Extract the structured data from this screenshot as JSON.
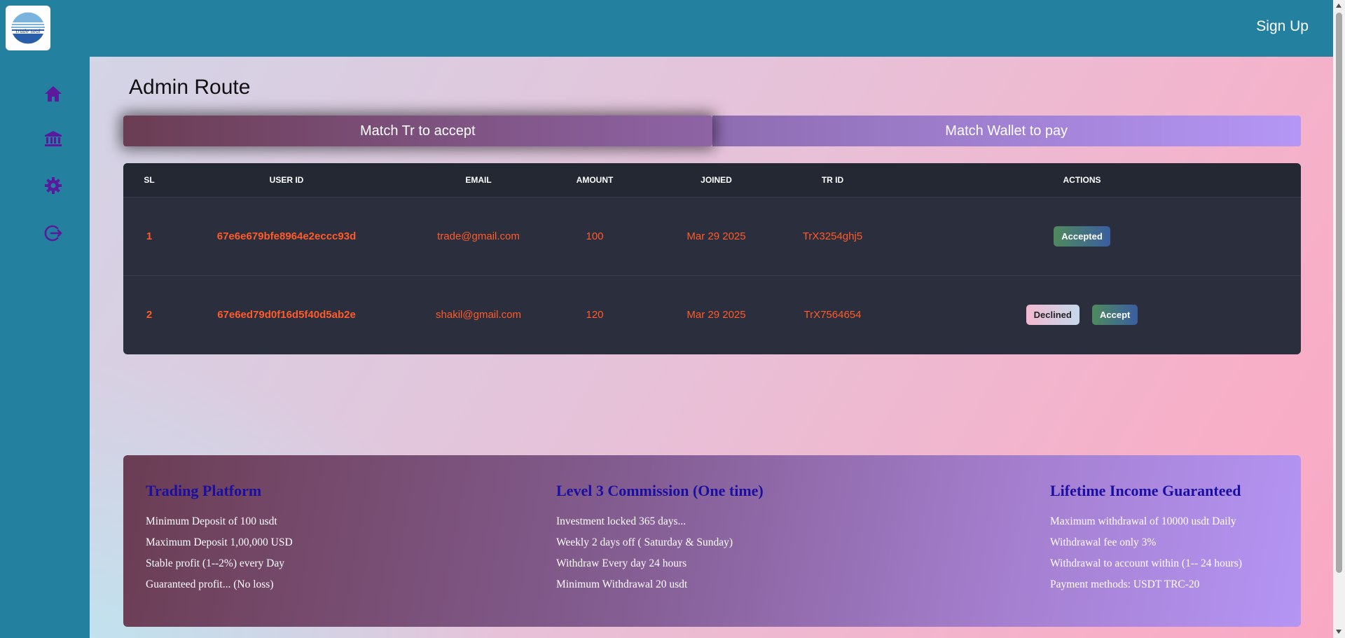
{
  "header": {
    "logo_text": "trade seal",
    "signup_label": "Sign Up"
  },
  "sidebar": {
    "items": [
      {
        "icon": "home-icon"
      },
      {
        "icon": "bank-icon"
      },
      {
        "icon": "gear-icon"
      },
      {
        "icon": "logout-icon"
      }
    ],
    "icon_color": "#5b1a9e"
  },
  "main": {
    "page_title": "Admin Route",
    "tabs": [
      {
        "label": "Match Tr to accept",
        "active": true
      },
      {
        "label": "Match Wallet to pay",
        "active": false
      }
    ]
  },
  "table": {
    "headers": [
      "SL",
      "USER ID",
      "EMAIL",
      "AMOUNT",
      "JOINED",
      "TR ID",
      "ACTIONS"
    ],
    "rows": [
      {
        "sl": "1",
        "user_id": "67e6e679bfe8964e2eccc93d",
        "email": "trade@gmail.com",
        "amount": "100",
        "joined": "Mar 29 2025",
        "tr_id": "TrX3254ghj5",
        "actions": [
          "Accepted"
        ]
      },
      {
        "sl": "2",
        "user_id": "67e6ed79d0f16d5f40d5ab2e",
        "email": "shakil@gmail.com",
        "amount": "120",
        "joined": "Mar 29 2025",
        "tr_id": "TrX7564654",
        "actions": [
          "Declined",
          "Accept"
        ]
      }
    ]
  },
  "footer": {
    "columns": [
      {
        "title": "Trading Platform",
        "lines": [
          "Minimum Deposit of 100 usdt",
          "Maximum Deposit 1,00,000 USD",
          "Stable profit (1--2%) every Day",
          "Guaranteed profit... (No loss)"
        ]
      },
      {
        "title": "Level 3 Commission (One time)",
        "lines": [
          "Investment locked 365 days...",
          "Weekly 2 days off ( Saturday & Sunday)",
          "Withdraw Every day 24 hours",
          "Minimum Withdrawal 20 usdt"
        ]
      },
      {
        "title": "Lifetime Income Guaranteed",
        "lines": [
          "Maximum withdrawal of 10000 usdt Daily",
          "Withdrawal fee only 3%",
          "Withdrawal to account within (1-- 24 hours)",
          "Payment methods: USDT TRC-20"
        ]
      }
    ]
  },
  "colors": {
    "topbar": "#23809f",
    "row_text": "#ff5a2a",
    "footer_title": "#1a0fa0"
  }
}
